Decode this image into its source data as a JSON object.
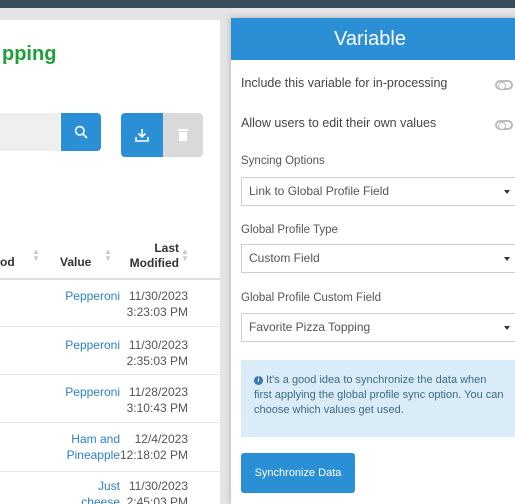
{
  "page": {
    "title": "pping"
  },
  "table": {
    "headers": {
      "method": "od",
      "value": "Value",
      "last_modified_line1": "Last",
      "last_modified_line2": "Modified"
    },
    "rows": [
      {
        "value_line1": "Pepperoni",
        "value_line2": "",
        "date": "11/30/2023",
        "time": "3:23:03 PM"
      },
      {
        "value_line1": "Pepperoni",
        "value_line2": "",
        "date": "11/30/2023",
        "time": "2:35:03 PM"
      },
      {
        "value_line1": "Pepperoni",
        "value_line2": "",
        "date": "11/28/2023",
        "time": "3:10:43 PM"
      },
      {
        "value_line1": "Ham and",
        "value_line2": "Pineapple",
        "date": "12/4/2023",
        "time": "12:18:02 PM"
      },
      {
        "value_line1": "Just",
        "value_line2": "cheese",
        "date": "11/30/2023",
        "time": "2:45:03 PM"
      }
    ]
  },
  "modal": {
    "title": "Variable",
    "include_label": "Include this variable for in-processing",
    "include_toggle_on": false,
    "allow_label": "Allow users to edit their own values",
    "allow_toggle_on": false,
    "syncing_label": "Syncing Options",
    "syncing_value": "Link to Global Profile Field",
    "type_label": "Global Profile Type",
    "type_value": "Custom Field",
    "field_label": "Global Profile Custom Field",
    "field_value": "Favorite Pizza Topping",
    "info_icon": "i",
    "info_text": "It's a good idea to synchronize the data when first applying the global profile sync option. You can choose which values get used.",
    "sync_button": "Synchronize Data"
  },
  "icons": {
    "search": "search-icon",
    "download": "download-icon",
    "delete": "trash-icon",
    "info": "info-icon",
    "caret": "caret-down-icon"
  },
  "colors": {
    "accent": "#2b8fd6",
    "title_green": "#1ea03a",
    "link_blue": "#2e7fc4",
    "info_bg": "#d9ecf7"
  }
}
